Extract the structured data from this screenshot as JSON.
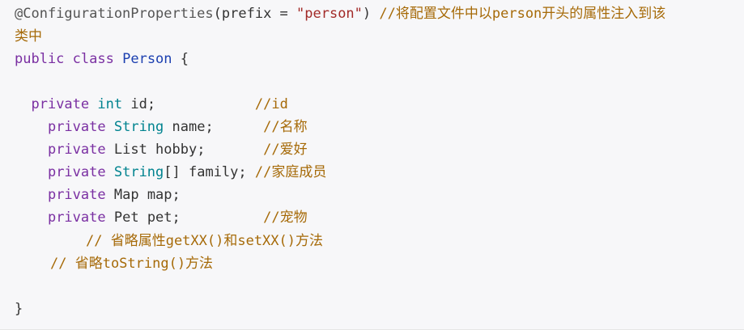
{
  "code": {
    "line1": {
      "annotation": "@ConfigurationProperties",
      "paren_open": "(",
      "attr": "prefix = ",
      "string": "\"person\"",
      "paren_close": ")",
      "gap": " ",
      "comment": "//将配置文件中以person开头的属性注入到该"
    },
    "line2": {
      "comment_cont": "类中"
    },
    "line3": {
      "kw1": "public",
      "kw2": "class",
      "class_name": "Person",
      "brace": "{"
    },
    "fields": [
      {
        "indent": "  ",
        "keyword": "private",
        "type": "int",
        "type_kind": "type",
        "rest": " id;",
        "pad": "            ",
        "comment": "//id"
      },
      {
        "indent": "    ",
        "keyword": "private",
        "type": "String",
        "type_kind": "type",
        "rest": " name;",
        "pad": "      ",
        "comment": "//名称"
      },
      {
        "indent": "    ",
        "keyword": "private",
        "type": "List",
        "type_kind": "plain",
        "rest": " hobby;",
        "pad": "       ",
        "comment": "//爱好"
      },
      {
        "indent": "    ",
        "keyword": "private",
        "type": "String",
        "type_kind": "type",
        "rest": "[] family;",
        "pad": " ",
        "comment": "//家庭成员"
      },
      {
        "indent": "    ",
        "keyword": "private",
        "type": "Map",
        "type_kind": "plain",
        "rest": " map;",
        "pad": "",
        "comment": ""
      },
      {
        "indent": "    ",
        "keyword": "private",
        "type": "Pet",
        "type_kind": "plain",
        "rest": " pet;",
        "pad": "          ",
        "comment": "//宠物"
      }
    ],
    "comment_getset": "// 省略属性getXX()和setXX()方法",
    "comment_tostring": "// 省略toString()方法",
    "closing_brace": "}"
  }
}
